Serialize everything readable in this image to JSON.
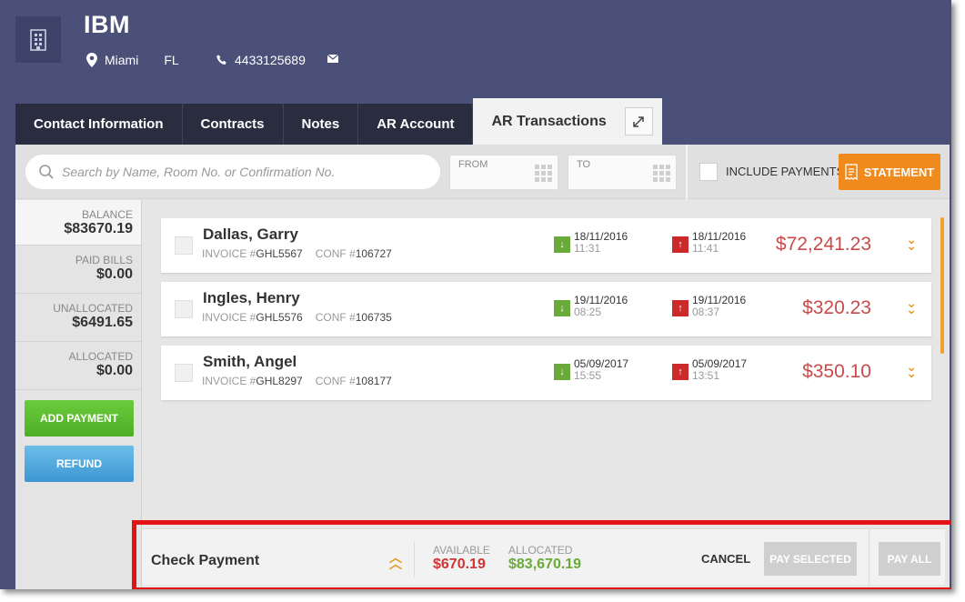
{
  "header": {
    "company": "IBM",
    "city": "Miami",
    "state": "FL",
    "phone": "4433125689",
    "icons": {
      "company": "building-icon",
      "location": "map-pin-icon",
      "phone": "phone-icon",
      "email": "envelope-icon"
    }
  },
  "tabs": [
    {
      "label": "Contact Information"
    },
    {
      "label": "Contracts"
    },
    {
      "label": "Notes"
    },
    {
      "label": "AR Account"
    },
    {
      "label": "AR Transactions",
      "active": true
    }
  ],
  "filters": {
    "search_placeholder": "Search by Name, Room No. or Confirmation No.",
    "from_label": "FROM",
    "to_label": "TO",
    "include_payments_label": "INCLUDE PAYMENTS",
    "include_payments_checked": false,
    "statement_label": "STATEMENT"
  },
  "sidebar": {
    "stats": [
      {
        "label": "BALANCE",
        "value": "$83670.19"
      },
      {
        "label": "PAID BILLS",
        "value": "$0.00"
      },
      {
        "label": "UNALLOCATED",
        "value": "$6491.65"
      },
      {
        "label": "ALLOCATED",
        "value": "$0.00"
      }
    ],
    "add_payment_label": "ADD PAYMENT",
    "refund_label": "REFUND"
  },
  "transactions": [
    {
      "name": "Dallas, Garry",
      "invoice_label": "INVOICE #",
      "invoice": "GHL5567",
      "conf_label": "CONF #",
      "conf": "106727",
      "in_date": "18/11/2016",
      "in_time": "11:31",
      "out_date": "18/11/2016",
      "out_time": "11:41",
      "amount": "$72,241.23"
    },
    {
      "name": "Ingles, Henry",
      "invoice_label": "INVOICE #",
      "invoice": "GHL5576",
      "conf_label": "CONF #",
      "conf": "106735",
      "in_date": "19/11/2016",
      "in_time": "08:25",
      "out_date": "19/11/2016",
      "out_time": "08:37",
      "amount": "$320.23"
    },
    {
      "name": "Smith, Angel",
      "invoice_label": "INVOICE #",
      "invoice": "GHL8297",
      "conf_label": "CONF #",
      "conf": "108177",
      "in_date": "05/09/2017",
      "in_time": "15:55",
      "out_date": "05/09/2017",
      "out_time": "13:51",
      "amount": "$350.10"
    }
  ],
  "payment_bar": {
    "title": "Check Payment",
    "available_label": "AVAILABLE",
    "available_value": "$670.19",
    "allocated_label": "ALLOCATED",
    "allocated_value": "$83,670.19",
    "cancel_label": "CANCEL",
    "pay_selected_label": "PAY SELECTED",
    "pay_all_label": "PAY ALL"
  },
  "colors": {
    "header_bg": "#4a5078",
    "tab_bg": "#2a2d40",
    "accent_orange": "#f08a1c",
    "green": "#6aaa3a",
    "red": "#cc2a2a",
    "amount_red": "#c84a4a",
    "highlight": "#e41212"
  }
}
